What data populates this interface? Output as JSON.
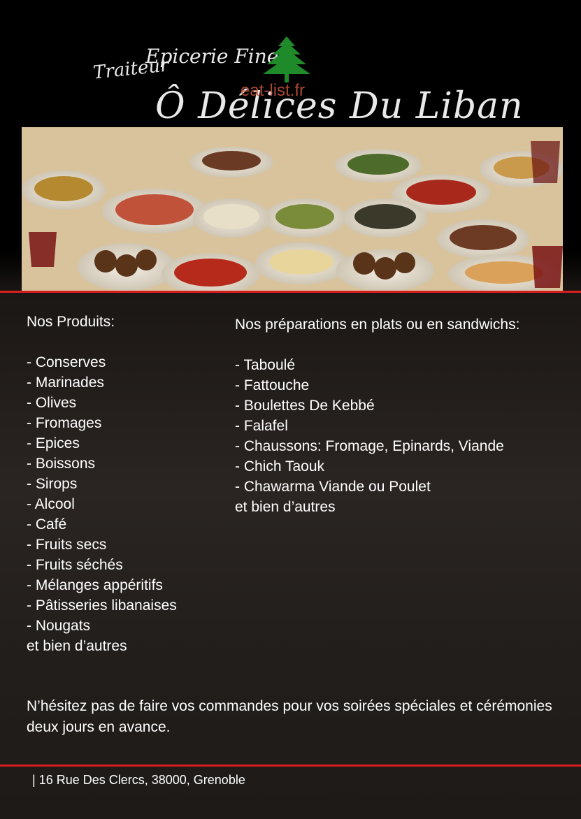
{
  "brand": {
    "traiteur": "Traiteur",
    "epicerie": "Epicerie Fine",
    "name": "Ô Délices Du Liban",
    "watermark": "eat-list.fr"
  },
  "products": {
    "heading": "Nos Produits:",
    "items": [
      "- Conserves",
      "- Marinades",
      "- Olives",
      "- Fromages",
      "- Epices",
      "- Boissons",
      "- Sirops",
      "- Alcool",
      "- Café",
      "- Fruits secs",
      "- Fruits séchés",
      "- Mélanges appéritifs",
      "- Pâtisseries libanaises",
      "- Nougats"
    ],
    "footer": "et bien d’autres"
  },
  "preparations": {
    "heading": "Nos préparations en plats ou en sandwichs:",
    "items": [
      "- Taboulé",
      "- Fattouche",
      "- Boulettes De Kebbé",
      "- Falafel",
      "- Chaussons: Fromage, Epinards, Viande",
      "- Chich Taouk",
      "- Chawarma Viande ou Poulet"
    ],
    "footer": "et bien d’autres"
  },
  "note": "N’hésitez pas de faire vos commandes pour vos soirées spéciales et cérémonies deux jours en avance.",
  "address": "| 16 Rue Des Clercs, 38000, Grenoble",
  "colors": {
    "accent_red": "#d91e1e",
    "cedar_green": "#1f8a2a"
  }
}
